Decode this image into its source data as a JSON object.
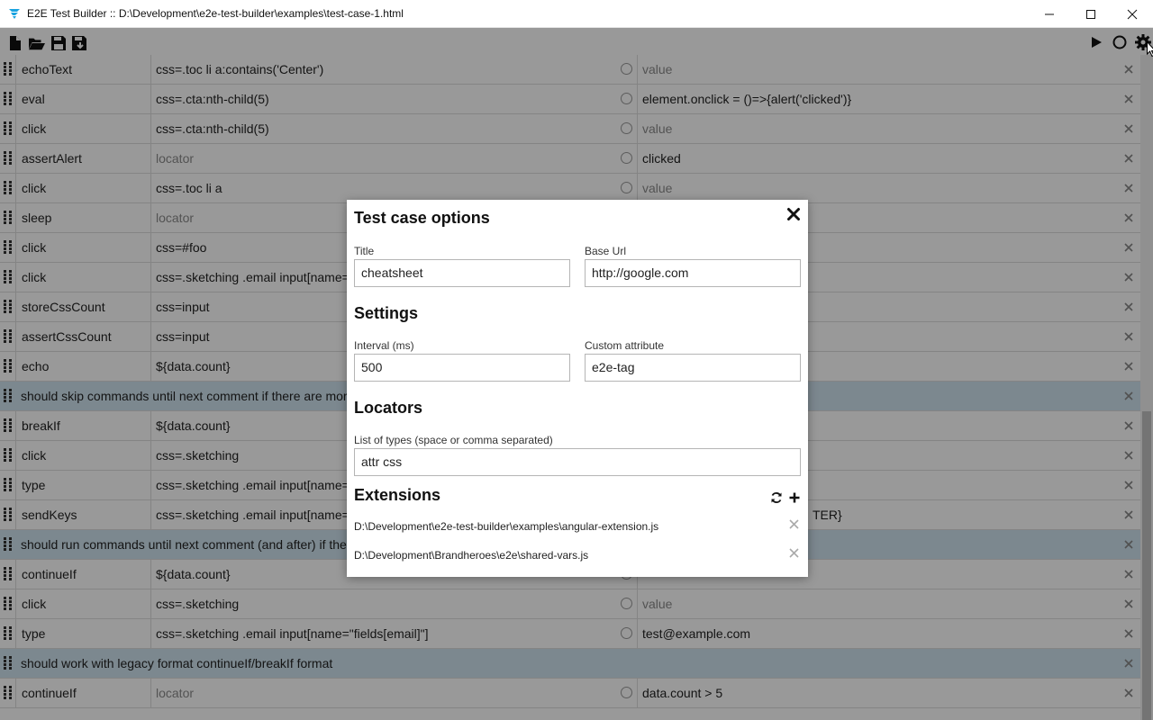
{
  "window": {
    "title": "E2E Test Builder :: D:\\Development\\e2e-test-builder\\examples\\test-case-1.html",
    "accent_color": "#1aa3e0"
  },
  "toolbar": {
    "left_icons": [
      "new-file-icon",
      "open-folder-icon",
      "save-icon",
      "save-as-icon"
    ],
    "right_icons": [
      "play-icon",
      "record-icon",
      "gear-icon"
    ]
  },
  "rows": [
    {
      "type": "command",
      "command": "echoText",
      "target": "css=.toc li a:contains('Center')",
      "target_placeholder": false,
      "value": "value",
      "value_placeholder": true
    },
    {
      "type": "command",
      "command": "eval",
      "target": "css=.cta:nth-child(5)",
      "target_placeholder": false,
      "value": "element.onclick = ()=>{alert('clicked')}",
      "value_placeholder": false
    },
    {
      "type": "command",
      "command": "click",
      "target": "css=.cta:nth-child(5)",
      "target_placeholder": false,
      "value": "value",
      "value_placeholder": true
    },
    {
      "type": "command",
      "command": "assertAlert",
      "target": "locator",
      "target_placeholder": true,
      "value": "clicked",
      "value_placeholder": false
    },
    {
      "type": "command",
      "command": "click",
      "target": "css=.toc li a",
      "target_placeholder": false,
      "value": "value",
      "value_placeholder": true
    },
    {
      "type": "command",
      "command": "sleep",
      "target": "locator",
      "target_placeholder": true,
      "value": "",
      "value_placeholder": false
    },
    {
      "type": "command",
      "command": "click",
      "target": "css=#foo",
      "target_placeholder": false,
      "value": "",
      "value_placeholder": false
    },
    {
      "type": "command",
      "command": "click",
      "target": "css=.sketching .email input[name=\"f",
      "target_placeholder": false,
      "value": "",
      "value_placeholder": false
    },
    {
      "type": "command",
      "command": "storeCssCount",
      "target": "css=input",
      "target_placeholder": false,
      "value": "",
      "value_placeholder": false
    },
    {
      "type": "command",
      "command": "assertCssCount",
      "target": "css=input",
      "target_placeholder": false,
      "value": "",
      "value_placeholder": false
    },
    {
      "type": "command",
      "command": "echo",
      "target": "${data.count}",
      "target_placeholder": false,
      "value": "",
      "value_placeholder": false
    },
    {
      "type": "comment",
      "text": "should skip commands until next comment if there are more th"
    },
    {
      "type": "command",
      "command": "breakIf",
      "target": "${data.count}",
      "target_placeholder": false,
      "value": "",
      "value_placeholder": false
    },
    {
      "type": "command",
      "command": "click",
      "target": "css=.sketching",
      "target_placeholder": false,
      "value": "",
      "value_placeholder": false
    },
    {
      "type": "command",
      "command": "type",
      "target": "css=.sketching .email input[name=\"f",
      "target_placeholder": false,
      "value": "",
      "value_placeholder": false
    },
    {
      "type": "command",
      "command": "sendKeys",
      "target": "css=.sketching .email input[name=\"f",
      "target_placeholder": false,
      "value": "TER}",
      "value_placeholder": false,
      "value_offset": true
    },
    {
      "type": "comment",
      "text": "should run commands until next comment (and after) if there a"
    },
    {
      "type": "command",
      "command": "continueIf",
      "target": "${data.count}",
      "target_placeholder": false,
      "value": "",
      "value_placeholder": false
    },
    {
      "type": "command",
      "command": "click",
      "target": "css=.sketching",
      "target_placeholder": false,
      "value": "value",
      "value_placeholder": true
    },
    {
      "type": "command",
      "command": "type",
      "target": "css=.sketching .email input[name=\"fields[email]\"]",
      "target_placeholder": false,
      "value": "test@example.com",
      "value_placeholder": false
    },
    {
      "type": "comment",
      "text": "should work with legacy format continueIf/breakIf format"
    },
    {
      "type": "command",
      "command": "continueIf",
      "target": "locator",
      "target_placeholder": true,
      "value": "data.count > 5",
      "value_placeholder": false
    }
  ],
  "modal": {
    "title": "Test case options",
    "title_label": "Title",
    "title_value": "cheatsheet",
    "base_url_label": "Base Url",
    "base_url_value": "http://google.com",
    "settings_heading": "Settings",
    "interval_label": "Interval (ms)",
    "interval_value": "500",
    "custom_attr_label": "Custom attribute",
    "custom_attr_value": "e2e-tag",
    "locators_heading": "Locators",
    "types_label": "List of types (space or comma separated)",
    "types_value": "attr css",
    "extensions_heading": "Extensions",
    "extensions": [
      "D:\\Development\\e2e-test-builder\\examples\\angular-extension.js",
      "D:\\Development\\Brandheroes\\e2e\\shared-vars.js"
    ]
  },
  "colors": {
    "comment_row_bg": "#cfe3ef",
    "overlay": "rgba(0,0,0,0.4)"
  }
}
